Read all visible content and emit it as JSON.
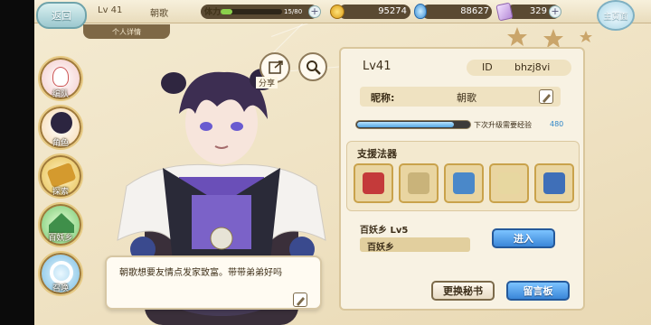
{
  "topbar": {
    "back_label": "返回",
    "level": "Lv 41",
    "name": "朝歌",
    "stamina_label": "体力",
    "stamina_text": "15/80",
    "stamina_fraction": 0.19,
    "gold": "95274",
    "gems": "88627",
    "tickets": "329",
    "home_label": "主页面"
  },
  "detail_tab": "个人详情",
  "sidenav": {
    "items": [
      {
        "label": "编队",
        "icon": "formation-icon",
        "color": "#e36b6b"
      },
      {
        "label": "角色",
        "icon": "character-icon",
        "color": "#e8a64a"
      },
      {
        "label": "探索",
        "icon": "explore-icon",
        "color": "#e4bc4c"
      },
      {
        "label": "百妖乡",
        "icon": "village-icon",
        "color": "#6fc46b"
      },
      {
        "label": "召唤",
        "icon": "summon-icon",
        "color": "#6fb8e0"
      }
    ]
  },
  "share_label": "分享",
  "dialogue": "朝歌想要友情点发家致富。带带弟弟好吗",
  "profile": {
    "level": "Lv41",
    "id_label": "ID",
    "id_value": "bhzj8vi",
    "nick_label": "昵称:",
    "nick_value": "朝歌",
    "exp_label": "下次升级需要经验",
    "exp_value": "480",
    "exp_fraction": 0.86,
    "support_title": "支援法器",
    "support_slots": [
      {
        "icon": "red-book-icon",
        "color": "#c43a3a"
      },
      {
        "icon": "ring-icon",
        "color": "#c9b37a"
      },
      {
        "icon": "potion-icon",
        "color": "#4a88c9"
      },
      {
        "icon": "crystal-ball-icon",
        "color": "#e7d7a0"
      },
      {
        "icon": "sword-icon",
        "color": "#3f6fb8"
      }
    ],
    "family_title": "百妖乡  Lv5",
    "family_name": "百妖乡",
    "enter_label": "进入",
    "secretary_label": "更换秘书",
    "message_label": "留言板"
  }
}
